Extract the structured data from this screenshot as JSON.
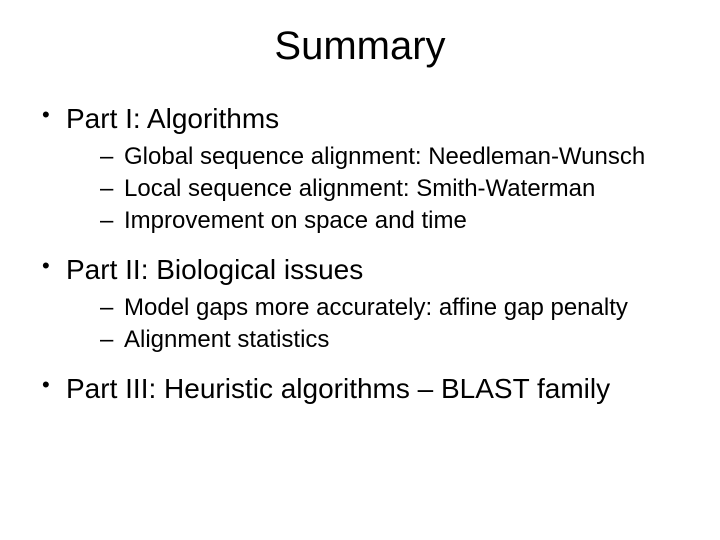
{
  "title": "Summary",
  "items": [
    {
      "label": "Part I: Algorithms",
      "sub": [
        "Global sequence alignment: Needleman-Wunsch",
        "Local sequence alignment: Smith-Waterman",
        "Improvement on space and time"
      ]
    },
    {
      "label": "Part II: Biological issues",
      "sub": [
        "Model gaps more accurately: affine gap penalty",
        "Alignment statistics"
      ]
    },
    {
      "label": "Part III: Heuristic algorithms – BLAST family",
      "sub": []
    }
  ]
}
